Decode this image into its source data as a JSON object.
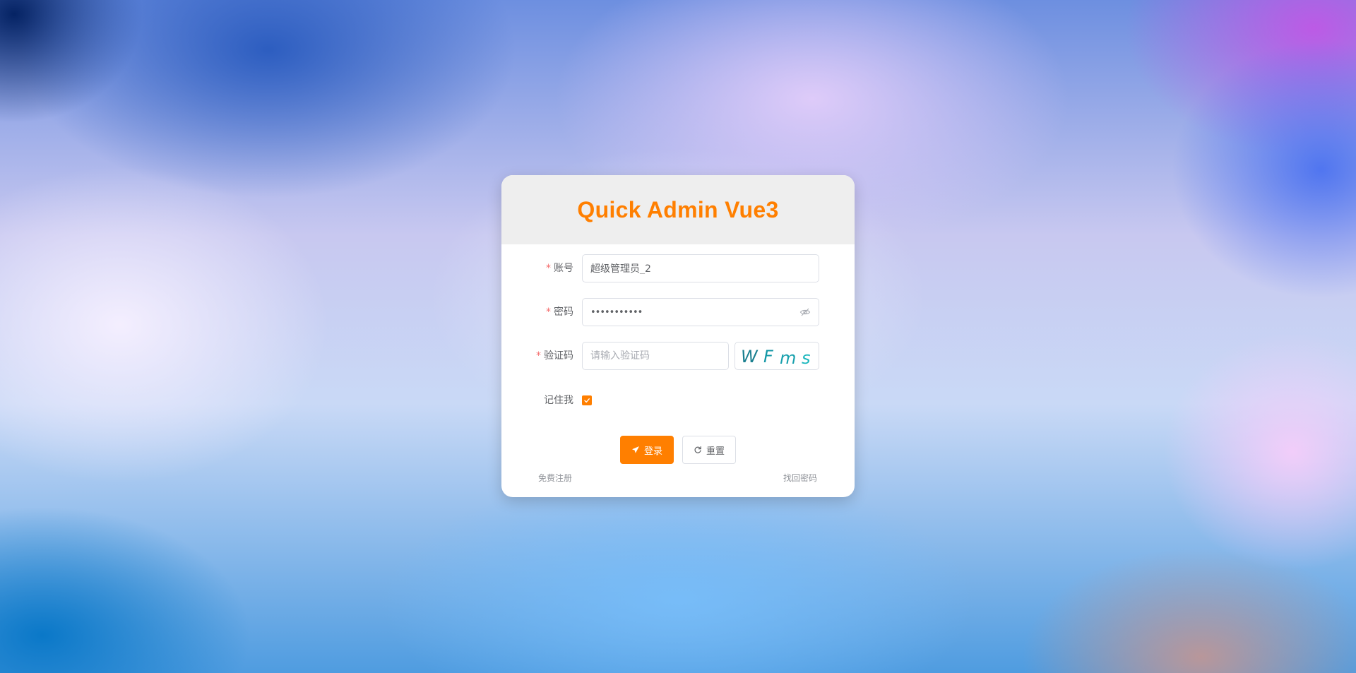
{
  "app": {
    "title": "Quick Admin Vue3"
  },
  "form": {
    "account": {
      "label": "账号",
      "required_mark": "*",
      "value": "超级管理员_2"
    },
    "password": {
      "label": "密码",
      "required_mark": "*",
      "masked_value": "•••••••••••",
      "toggle_icon": "eye-hidden-icon"
    },
    "captcha": {
      "label": "验证码",
      "required_mark": "*",
      "placeholder": "请输入验证码",
      "value": "",
      "image_chars": [
        "W",
        "F",
        "m",
        "s"
      ],
      "image_colors": [
        "#1a7f8f",
        "#1196a5",
        "#17a0ad",
        "#1bb7bd"
      ]
    },
    "remember": {
      "label": "记住我",
      "checked": true
    }
  },
  "buttons": {
    "login": {
      "label": "登录",
      "icon": "paper-plane-icon"
    },
    "reset": {
      "label": "重置",
      "icon": "refresh-icon"
    }
  },
  "links": {
    "register": "免费注册",
    "forgot_password": "找回密码"
  },
  "colors": {
    "accent": "#ff7f00",
    "required": "#f56c6c"
  }
}
